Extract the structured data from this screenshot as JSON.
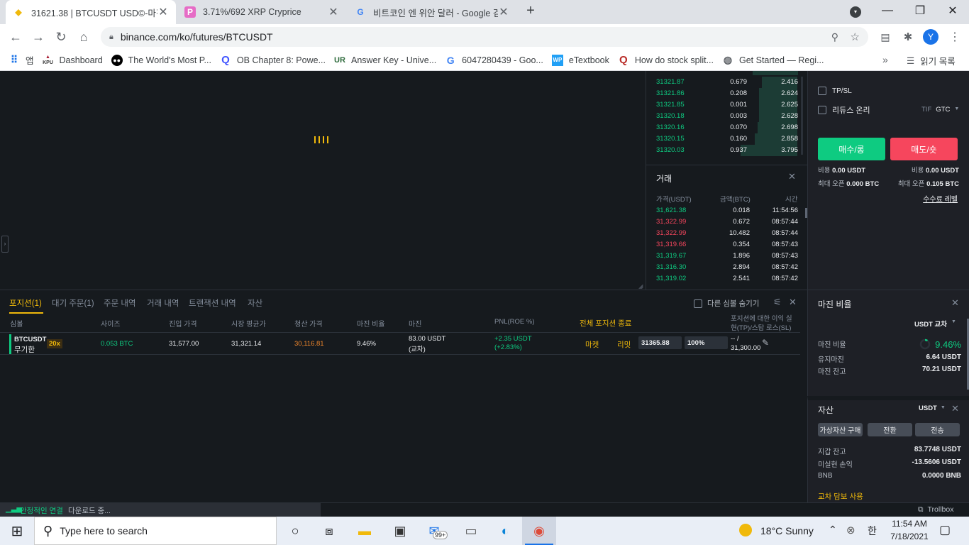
{
  "browser": {
    "tabs": [
      {
        "title": "31621.38 | BTCUSDT USD©-마진",
        "favicon": "binance-icon",
        "active": true
      },
      {
        "title": "3.71%/692 XRP Cryprice",
        "favicon": "cryprice-icon",
        "active": false
      },
      {
        "title": "비트코인 엔 위안 달러 - Google 검색",
        "favicon": "google-icon",
        "active": false
      }
    ],
    "url": "binance.com/ko/futures/BTCUSDT",
    "profile_initial": "Y",
    "bookmarks": [
      {
        "label": "앱",
        "icon": "apps-icon"
      },
      {
        "label": "Dashboard",
        "icon": "kpu-icon"
      },
      {
        "label": "The World's Most P...",
        "icon": "medium-icon"
      },
      {
        "label": "OB Chapter 8: Powe...",
        "icon": "quizlet-icon"
      },
      {
        "label": "Answer Key - Unive...",
        "icon": "ur-icon"
      },
      {
        "label": "6047280439 - Goo...",
        "icon": "google-icon"
      },
      {
        "label": "eTextbook",
        "icon": "wp-icon"
      },
      {
        "label": "How do stock split...",
        "icon": "quora-icon"
      },
      {
        "label": "Get Started — Regi...",
        "icon": "globe-icon"
      }
    ],
    "reading_list": "읽기 목록",
    "kpu_label": "KPU"
  },
  "orderbook": {
    "rows": [
      {
        "price": "31321.87",
        "amount": "0.679",
        "total": "2.416",
        "depth": 0.25
      },
      {
        "price": "31321.86",
        "amount": "0.208",
        "total": "2.624",
        "depth": 0.27
      },
      {
        "price": "31321.85",
        "amount": "0.001",
        "total": "2.625",
        "depth": 0.27
      },
      {
        "price": "31320.18",
        "amount": "0.003",
        "total": "2.628",
        "depth": 0.27
      },
      {
        "price": "31320.16",
        "amount": "0.070",
        "total": "2.698",
        "depth": 0.28
      },
      {
        "price": "31320.15",
        "amount": "0.160",
        "total": "2.858",
        "depth": 0.3
      },
      {
        "price": "31320.03",
        "amount": "0.937",
        "total": "3.795",
        "depth": 0.4
      }
    ]
  },
  "trades": {
    "title": "거래",
    "headers": {
      "price": "가격(USDT)",
      "amount": "금액(BTC)",
      "time": "시간"
    },
    "rows": [
      {
        "price": "31,621.38",
        "amount": "0.018",
        "time": "11:54:56",
        "side": "buy"
      },
      {
        "price": "31,322.99",
        "amount": "0.672",
        "time": "08:57:44",
        "side": "sell"
      },
      {
        "price": "31,322.99",
        "amount": "10.482",
        "time": "08:57:44",
        "side": "sell"
      },
      {
        "price": "31,319.66",
        "amount": "0.354",
        "time": "08:57:43",
        "side": "sell"
      },
      {
        "price": "31,319.67",
        "amount": "1.896",
        "time": "08:57:43",
        "side": "buy"
      },
      {
        "price": "31,316.30",
        "amount": "2.894",
        "time": "08:57:42",
        "side": "buy"
      },
      {
        "price": "31,319.02",
        "amount": "2.541",
        "time": "08:57:42",
        "side": "buy"
      }
    ]
  },
  "order_form": {
    "tpsl": "TP/SL",
    "reduce_only": "리듀스 온리",
    "tif_label": "TIF",
    "tif_value": "GTC",
    "buy_label": "매수/롱",
    "sell_label": "매도/숏",
    "cost_label": "비용",
    "buy_cost": "0.00 USDT",
    "sell_cost": "0.00 USDT",
    "max_open_label": "최대 오픈",
    "buy_max": "0.000 BTC",
    "sell_max": "0.105 BTC",
    "fee_level": "수수료 레벨"
  },
  "positions": {
    "tabs": [
      "포지션(1)",
      "대기 주문(1)",
      "주문 내역",
      "거래 내역",
      "트랜잭션 내역",
      "자산"
    ],
    "hide_other": "다른 심볼 숨기기",
    "headers": {
      "symbol": "심볼",
      "size": "사이즈",
      "entry": "진입 가격",
      "mark": "시장 평균가",
      "liq": "청산 가격",
      "margin_ratio": "마진 비율",
      "margin": "마진",
      "pnl": "PNL(ROE %)",
      "close_all": "전체 포지션 종료",
      "tpsl_line1": "포지션에 대한 이익 실",
      "tpsl_line2": "현(TP)/스탑 로스(SL)"
    },
    "row": {
      "symbol": "BTCUSDT",
      "mode": "무기한",
      "leverage": "20x",
      "size": "0.053 BTC",
      "entry": "31,577.00",
      "mark": "31,321.14",
      "liq": "30,116.81",
      "margin_ratio": "9.46%",
      "margin": "83.00 USDT",
      "margin_mode": "(교차)",
      "pnl": "+2.35 USDT",
      "roe": "(+2.83%)",
      "market_btn": "마켓",
      "limit_btn": "리밋",
      "limit_price": "31365.88",
      "limit_pct": "100%",
      "tpsl_value1": "-- /",
      "tpsl_value2": "31,300.00"
    }
  },
  "margin_panel": {
    "title": "마진 비율",
    "mode": "USDT 교차",
    "ratio_label": "마진 비율",
    "ratio_value": "9.46%",
    "maint_label": "유지마진",
    "maint_value": "6.64 USDT",
    "balance_label": "마진 잔고",
    "balance_value": "70.21 USDT",
    "gauge_fraction": 0.0946
  },
  "assets_panel": {
    "title": "자산",
    "currency": "USDT",
    "btn_buy": "가상자산 구매",
    "btn_convert": "전환",
    "btn_transfer": "전송",
    "wallet_label": "지갑 잔고",
    "wallet_value": "83.7748 USDT",
    "unreal_label": "미실현 손익",
    "unreal_value": "-13.5606 USDT",
    "bnb_label": "BNB",
    "bnb_value": "0.0000 BNB",
    "collateral": "교차 담보 사용"
  },
  "status": {
    "connection": "안정적인 연결",
    "download": "다운로드 중...",
    "trollbox": "Trollbox"
  },
  "taskbar": {
    "search_placeholder": "Type here to search",
    "mail_badge": "99+",
    "weather": "18°C  Sunny",
    "ime": "한",
    "time": "11:54 AM",
    "date": "7/18/2021"
  },
  "colors": {
    "buy": "#0ecb81",
    "sell": "#f6465d",
    "accent": "#f0b90b",
    "background": "#161a1e"
  }
}
